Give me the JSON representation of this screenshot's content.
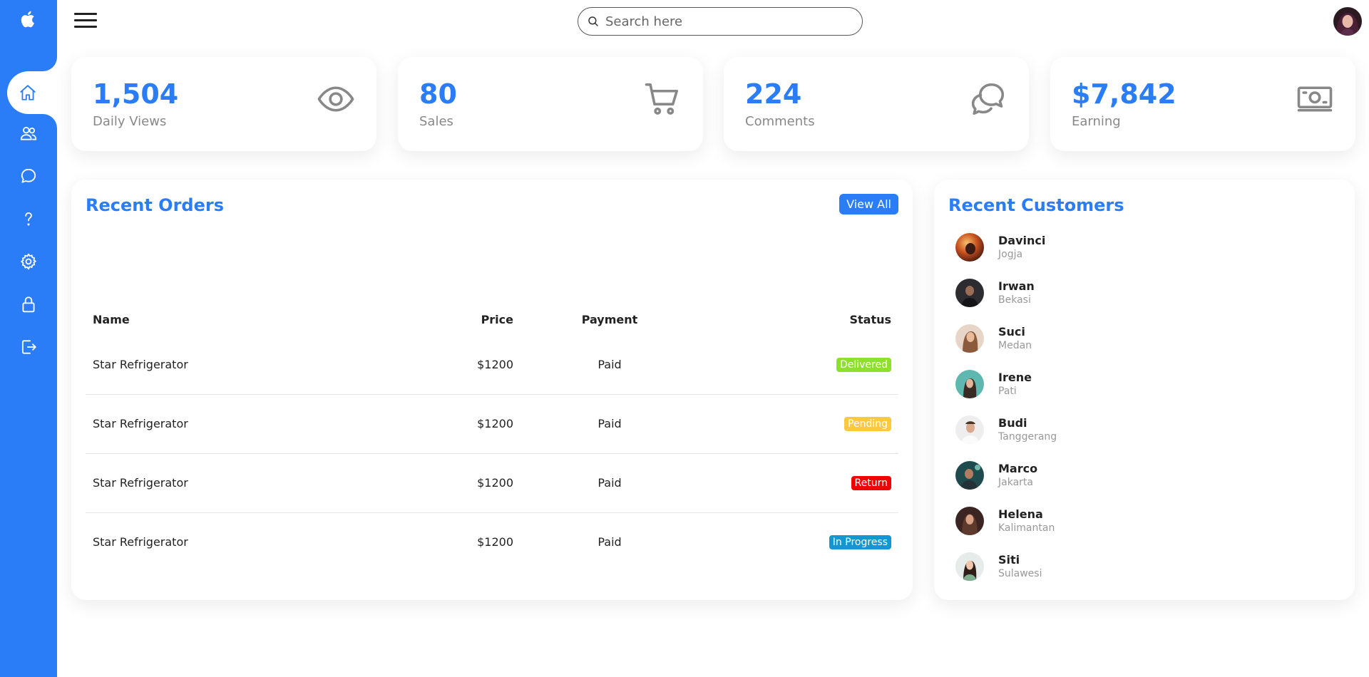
{
  "app": {
    "accent": "#2a7cf7"
  },
  "sidebar": {
    "items": [
      {
        "name": "home",
        "icon": "home-icon",
        "active": true
      },
      {
        "name": "customers",
        "icon": "people-icon"
      },
      {
        "name": "messages",
        "icon": "chat-icon"
      },
      {
        "name": "help",
        "icon": "help-icon"
      },
      {
        "name": "settings",
        "icon": "gear-icon"
      },
      {
        "name": "password",
        "icon": "lock-icon"
      },
      {
        "name": "sign-out",
        "icon": "logout-icon"
      }
    ]
  },
  "topbar": {
    "search_placeholder": "Search here"
  },
  "cards": [
    {
      "number": "1,504",
      "label": "Daily Views",
      "icon": "eye-icon"
    },
    {
      "number": "80",
      "label": "Sales",
      "icon": "cart-icon"
    },
    {
      "number": "224",
      "label": "Comments",
      "icon": "chat-bubbles-icon"
    },
    {
      "number": "$7,842",
      "label": "Earning",
      "icon": "cash-icon"
    }
  ],
  "orders": {
    "title": "Recent Orders",
    "view_all": "View All",
    "columns": {
      "name": "Name",
      "price": "Price",
      "payment": "Payment",
      "status": "Status"
    },
    "rows": [
      {
        "name": "Star Refrigerator",
        "price": "$1200",
        "payment": "Paid",
        "status": "Delivered",
        "status_color": "#8de02c"
      },
      {
        "name": "Star Refrigerator",
        "price": "$1200",
        "payment": "Paid",
        "status": "Pending",
        "status_color": "#f9ca3f"
      },
      {
        "name": "Star Refrigerator",
        "price": "$1200",
        "payment": "Paid",
        "status": "Return",
        "status_color": "#f00000"
      },
      {
        "name": "Star Refrigerator",
        "price": "$1200",
        "payment": "Paid",
        "status": "In Progress",
        "status_color": "#1795ce"
      }
    ]
  },
  "customers": {
    "title": "Recent Customers",
    "list": [
      {
        "name": "Davinci",
        "city": "Jogja"
      },
      {
        "name": "Irwan",
        "city": "Bekasi"
      },
      {
        "name": "Suci",
        "city": "Medan"
      },
      {
        "name": "Irene",
        "city": "Pati"
      },
      {
        "name": "Budi",
        "city": "Tanggerang"
      },
      {
        "name": "Marco",
        "city": "Jakarta"
      },
      {
        "name": "Helena",
        "city": "Kalimantan"
      },
      {
        "name": "Siti",
        "city": "Sulawesi"
      }
    ]
  }
}
